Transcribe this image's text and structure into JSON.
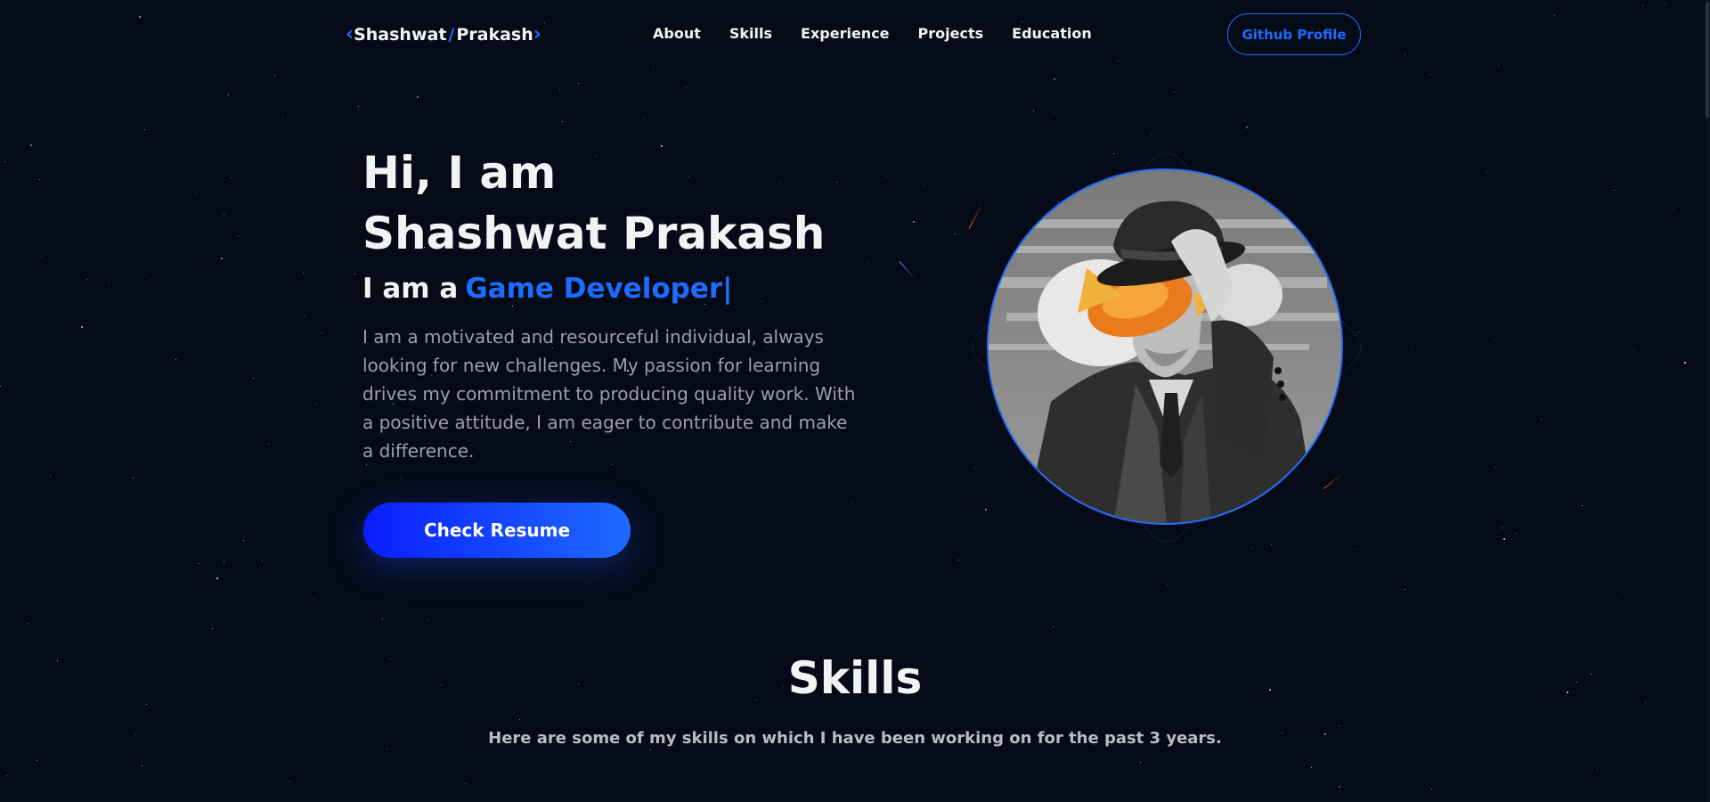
{
  "nav": {
    "logo_first": "Shashwat",
    "logo_slash": "/",
    "logo_last": "Prakash",
    "links": [
      "About",
      "Skills",
      "Experience",
      "Projects",
      "Education"
    ],
    "github_button": "Github Profile"
  },
  "hero": {
    "greeting": "Hi, I am",
    "name": "Shashwat Prakash",
    "role_prefix": "I am a",
    "role": "Game Developer",
    "cursor": "|",
    "description": "I am a motivated and resourceful individual, always looking for new challenges. My passion for learning drives my commitment to producing quality work. With a positive attitude, I am eager to contribute and make a difference.",
    "resume_button": "Check Resume"
  },
  "skills": {
    "title": "Skills",
    "subtitle": "Here are some of my skills on which I have been working on for the past 3 years."
  },
  "colors": {
    "background": "#050a17",
    "accent": "#1e6bff",
    "text": "#f2f3f5",
    "muted": "#9aa0ab"
  }
}
